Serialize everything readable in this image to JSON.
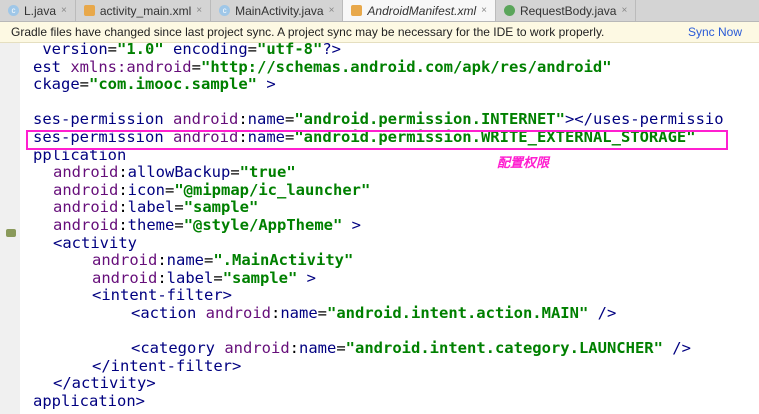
{
  "tabs": [
    {
      "label": "L.java",
      "icon": "c",
      "active": false
    },
    {
      "label": "activity_main.xml",
      "icon": "x",
      "active": false
    },
    {
      "label": "MainActivity.java",
      "icon": "c",
      "active": false
    },
    {
      "label": "AndroidManifest.xml",
      "icon": "x",
      "active": true
    },
    {
      "label": "RequestBody.java",
      "icon": "g",
      "active": false
    }
  ],
  "banner": {
    "message": "Gradle files have changed since last project sync. A project sync may be necessary for the IDE to work properly.",
    "action": "Sync Now"
  },
  "annotation": "配置权限",
  "colors": {
    "tag": "#000080",
    "ns": "#660e7a",
    "value": "#008000",
    "highlight": "#ff1fd0"
  },
  "code_lines": [
    {
      "indent": 0,
      "segs": [
        [
          "tag",
          " version"
        ],
        [
          "plain",
          "="
        ],
        [
          "val",
          "\"1.0\""
        ],
        [
          "tag",
          " encoding"
        ],
        [
          "plain",
          "="
        ],
        [
          "val",
          "\"utf-8\""
        ],
        [
          "tag",
          "?>"
        ]
      ]
    },
    {
      "indent": 0,
      "segs": [
        [
          "tag",
          "est "
        ],
        [
          "ns",
          "xmlns:android"
        ],
        [
          "plain",
          "="
        ],
        [
          "val",
          "\"http://schemas.android.com/apk/res/android\""
        ]
      ]
    },
    {
      "indent": 0,
      "segs": [
        [
          "tag",
          "ckage"
        ],
        [
          "plain",
          "="
        ],
        [
          "val",
          "\"com.imooc.sample\""
        ],
        [
          "tag",
          " >"
        ]
      ]
    },
    {
      "indent": 0,
      "segs": []
    },
    {
      "indent": 0,
      "segs": [
        [
          "tag",
          "ses-permission "
        ],
        [
          "ns",
          "android"
        ],
        [
          "plain",
          ":"
        ],
        [
          "tag",
          "name"
        ],
        [
          "plain",
          "="
        ],
        [
          "val",
          "\"android.permission.INTERNET\""
        ],
        [
          "tag",
          "></uses-permissio"
        ]
      ]
    },
    {
      "indent": 0,
      "segs": [
        [
          "tag",
          "ses-permission "
        ],
        [
          "ns",
          "android"
        ],
        [
          "plain",
          ":"
        ],
        [
          "tag",
          "name"
        ],
        [
          "plain",
          "="
        ],
        [
          "val",
          "\"android.permission.WRITE_EXTERNAL_STORAGE\""
        ]
      ]
    },
    {
      "indent": 0,
      "segs": [
        [
          "tag",
          "pplication"
        ]
      ]
    },
    {
      "indent": 1,
      "segs": [
        [
          "ns",
          "android"
        ],
        [
          "plain",
          ":"
        ],
        [
          "tag",
          "allowBackup"
        ],
        [
          "plain",
          "="
        ],
        [
          "val",
          "\"true\""
        ]
      ]
    },
    {
      "indent": 1,
      "segs": [
        [
          "ns",
          "android"
        ],
        [
          "plain",
          ":"
        ],
        [
          "tag",
          "icon"
        ],
        [
          "plain",
          "="
        ],
        [
          "val",
          "\"@mipmap/ic_launcher\""
        ]
      ]
    },
    {
      "indent": 1,
      "segs": [
        [
          "ns",
          "android"
        ],
        [
          "plain",
          ":"
        ],
        [
          "tag",
          "label"
        ],
        [
          "plain",
          "="
        ],
        [
          "val",
          "\"sample\""
        ]
      ]
    },
    {
      "indent": 1,
      "segs": [
        [
          "ns",
          "android"
        ],
        [
          "plain",
          ":"
        ],
        [
          "tag",
          "theme"
        ],
        [
          "plain",
          "="
        ],
        [
          "val",
          "\"@style/AppTheme\""
        ],
        [
          "tag",
          " >"
        ]
      ]
    },
    {
      "indent": 1,
      "segs": [
        [
          "tag",
          "<activity"
        ]
      ]
    },
    {
      "indent": 2,
      "segs": [
        [
          "ns",
          "android"
        ],
        [
          "plain",
          ":"
        ],
        [
          "tag",
          "name"
        ],
        [
          "plain",
          "="
        ],
        [
          "val",
          "\".MainActivity\""
        ]
      ]
    },
    {
      "indent": 2,
      "segs": [
        [
          "ns",
          "android"
        ],
        [
          "plain",
          ":"
        ],
        [
          "tag",
          "label"
        ],
        [
          "plain",
          "="
        ],
        [
          "val",
          "\"sample\""
        ],
        [
          "tag",
          " >"
        ]
      ]
    },
    {
      "indent": 2,
      "segs": [
        [
          "tag",
          "<intent-filter>"
        ]
      ]
    },
    {
      "indent": 3,
      "segs": [
        [
          "tag",
          "<action "
        ],
        [
          "ns",
          "android"
        ],
        [
          "plain",
          ":"
        ],
        [
          "tag",
          "name"
        ],
        [
          "plain",
          "="
        ],
        [
          "val",
          "\"android.intent.action.MAIN\""
        ],
        [
          "tag",
          " />"
        ]
      ]
    },
    {
      "indent": 0,
      "segs": []
    },
    {
      "indent": 3,
      "segs": [
        [
          "tag",
          "<category "
        ],
        [
          "ns",
          "android"
        ],
        [
          "plain",
          ":"
        ],
        [
          "tag",
          "name"
        ],
        [
          "plain",
          "="
        ],
        [
          "val",
          "\"android.intent.category.LAUNCHER\""
        ],
        [
          "tag",
          " />"
        ]
      ]
    },
    {
      "indent": 2,
      "segs": [
        [
          "tag",
          "</intent-filter>"
        ]
      ]
    },
    {
      "indent": 1,
      "segs": [
        [
          "tag",
          "</activity>"
        ]
      ]
    },
    {
      "indent": 0,
      "segs": [
        [
          "tag",
          "application>"
        ]
      ]
    }
  ]
}
